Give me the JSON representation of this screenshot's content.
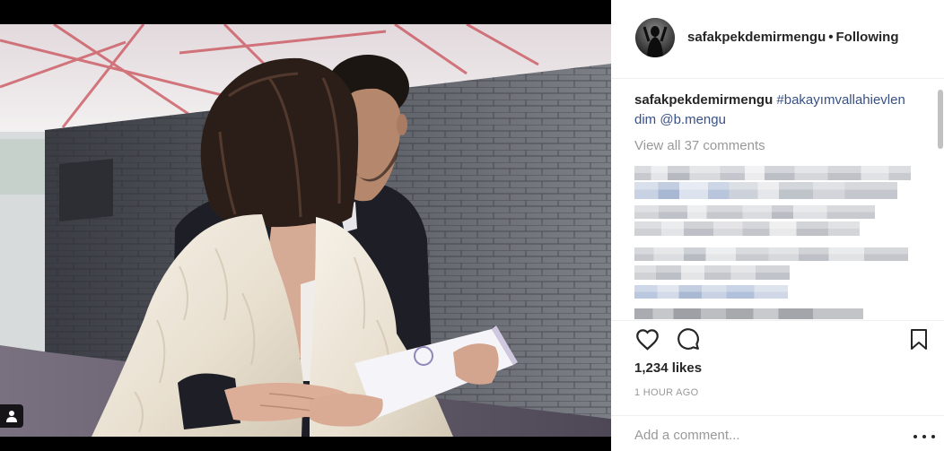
{
  "post": {
    "header": {
      "username": "safakpekdemirmengu",
      "separator": "•",
      "follow_status": "Following"
    },
    "caption": {
      "username": "safakpekdemirmengu",
      "hashtag": "#bakayımvallahievlendim",
      "mention": "@b.mengu"
    },
    "view_all_comments": "View all 37 comments",
    "likes": "1,234 likes",
    "timestamp": "1 HOUR AGO",
    "add_comment": {
      "placeholder": "Add a comment..."
    }
  },
  "icons": {
    "avatar": "profile-avatar",
    "user_tag": "user-tag-icon",
    "like": "heart-outline-icon",
    "comment": "comment-bubble-icon",
    "save": "bookmark-outline-icon",
    "more": "more-options-icon"
  },
  "colors": {
    "text": "#262626",
    "link": "#385185",
    "muted": "#999999",
    "border": "#efefef",
    "photo_background": "#000000"
  }
}
